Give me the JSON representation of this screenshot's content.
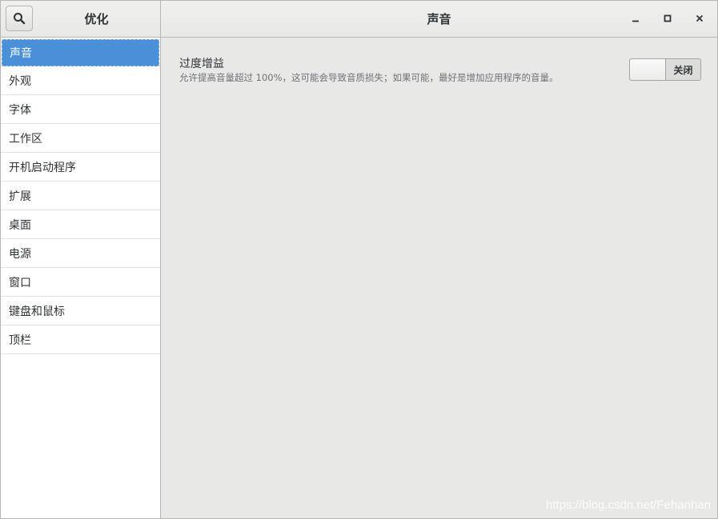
{
  "header": {
    "app_title": "优化",
    "page_title": "声音"
  },
  "sidebar": {
    "items": [
      {
        "label": "声音",
        "selected": true
      },
      {
        "label": "外观"
      },
      {
        "label": "字体"
      },
      {
        "label": "工作区"
      },
      {
        "label": "开机启动程序"
      },
      {
        "label": "扩展"
      },
      {
        "label": "桌面"
      },
      {
        "label": "电源"
      },
      {
        "label": "窗口"
      },
      {
        "label": "键盘和鼠标"
      },
      {
        "label": "顶栏"
      }
    ]
  },
  "main": {
    "setting": {
      "title": "过度增益",
      "description": "允许提高音量超过 100%，这可能会导致音质损失；如果可能，最好是增加应用程序的音量。",
      "switch_label": "关闭",
      "switch_on": false
    }
  },
  "watermark": "https://blog.csdn.net/Fehanhan",
  "icons": {
    "search": "search-icon",
    "minimize": "minimize-icon",
    "maximize": "maximize-icon",
    "close": "close-icon"
  },
  "colors": {
    "selection": "#4a90d9"
  }
}
